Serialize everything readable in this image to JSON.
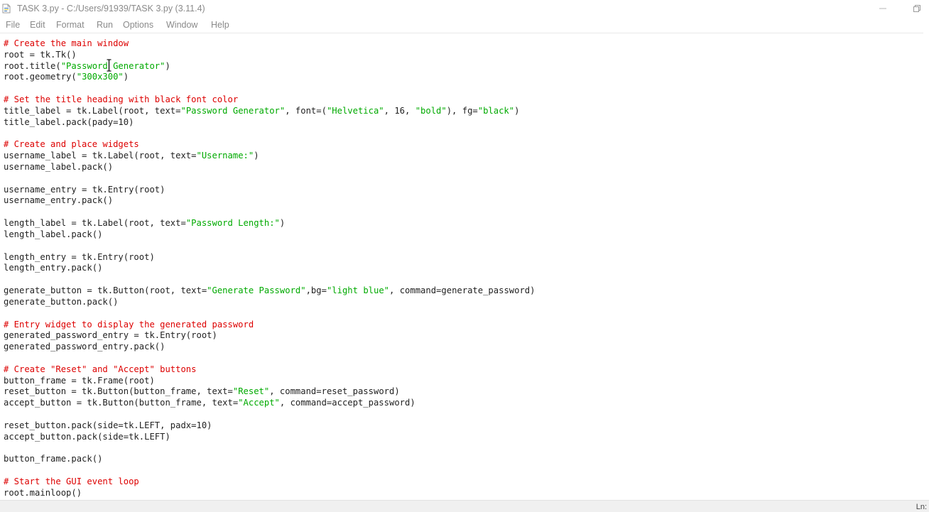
{
  "window": {
    "title": "TASK 3.py - C:/Users/91939/TASK 3.py (3.11.4)",
    "controls": [
      "minimize-icon",
      "maximize-icon"
    ]
  },
  "menu": [
    "File",
    "Edit",
    "Format",
    "Run",
    "Options",
    "Window",
    "Help"
  ],
  "code": [
    [
      [
        "# Create the main window",
        "comment"
      ]
    ],
    [
      [
        "root = tk.Tk()",
        "code"
      ]
    ],
    [
      [
        "root.title(",
        "code"
      ],
      [
        "\"Password Generator\"",
        "string"
      ],
      [
        ")",
        "code"
      ]
    ],
    [
      [
        "root.geometry(",
        "code"
      ],
      [
        "\"300x300\"",
        "string"
      ],
      [
        ")",
        "code"
      ]
    ],
    [],
    [
      [
        "# Set the title heading with black font color",
        "comment"
      ]
    ],
    [
      [
        "title_label = tk.Label(root, text=",
        "code"
      ],
      [
        "\"Password Generator\"",
        "string"
      ],
      [
        ", font=(",
        "code"
      ],
      [
        "\"Helvetica\"",
        "string"
      ],
      [
        ", 16, ",
        "code"
      ],
      [
        "\"bold\"",
        "string"
      ],
      [
        "), fg=",
        "code"
      ],
      [
        "\"black\"",
        "string"
      ],
      [
        ")",
        "code"
      ]
    ],
    [
      [
        "title_label.pack(pady=10)",
        "code"
      ]
    ],
    [],
    [
      [
        "# Create and place widgets",
        "comment"
      ]
    ],
    [
      [
        "username_label = tk.Label(root, text=",
        "code"
      ],
      [
        "\"Username:\"",
        "string"
      ],
      [
        ")",
        "code"
      ]
    ],
    [
      [
        "username_label.pack()",
        "code"
      ]
    ],
    [],
    [
      [
        "username_entry = tk.Entry(root)",
        "code"
      ]
    ],
    [
      [
        "username_entry.pack()",
        "code"
      ]
    ],
    [],
    [
      [
        "length_label = tk.Label(root, text=",
        "code"
      ],
      [
        "\"Password Length:\"",
        "string"
      ],
      [
        ")",
        "code"
      ]
    ],
    [
      [
        "length_label.pack()",
        "code"
      ]
    ],
    [],
    [
      [
        "length_entry = tk.Entry(root)",
        "code"
      ]
    ],
    [
      [
        "length_entry.pack()",
        "code"
      ]
    ],
    [],
    [
      [
        "generate_button = tk.Button(root, text=",
        "code"
      ],
      [
        "\"Generate Password\"",
        "string"
      ],
      [
        ",bg=",
        "code"
      ],
      [
        "\"light blue\"",
        "string"
      ],
      [
        ", command=generate_password)",
        "code"
      ]
    ],
    [
      [
        "generate_button.pack()",
        "code"
      ]
    ],
    [],
    [
      [
        "# Entry widget to display the generated password",
        "comment"
      ]
    ],
    [
      [
        "generated_password_entry = tk.Entry(root)",
        "code"
      ]
    ],
    [
      [
        "generated_password_entry.pack()",
        "code"
      ]
    ],
    [],
    [
      [
        "# Create \"Reset\" and \"Accept\" buttons",
        "comment"
      ]
    ],
    [
      [
        "button_frame = tk.Frame(root)",
        "code"
      ]
    ],
    [
      [
        "reset_button = tk.Button(button_frame, text=",
        "code"
      ],
      [
        "\"Reset\"",
        "string"
      ],
      [
        ", command=reset_password)",
        "code"
      ]
    ],
    [
      [
        "accept_button = tk.Button(button_frame, text=",
        "code"
      ],
      [
        "\"Accept\"",
        "string"
      ],
      [
        ", command=accept_password)",
        "code"
      ]
    ],
    [],
    [
      [
        "reset_button.pack(side=tk.LEFT, padx=10)",
        "code"
      ]
    ],
    [
      [
        "accept_button.pack(side=tk.LEFT)",
        "code"
      ]
    ],
    [],
    [
      [
        "button_frame.pack()",
        "code"
      ]
    ],
    [],
    [
      [
        "# Start the GUI event loop",
        "comment"
      ]
    ],
    [
      [
        "root.mainloop()",
        "code"
      ]
    ]
  ],
  "status": {
    "position": "Ln:"
  },
  "colors": {
    "comment": "#dd0000",
    "string": "#00aa00",
    "code": "#222222"
  }
}
